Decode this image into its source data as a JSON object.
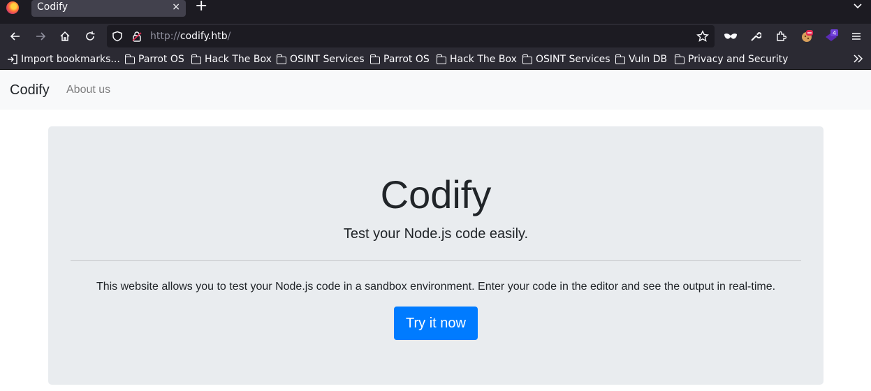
{
  "browser": {
    "tab": {
      "title": "Codify",
      "close": "×"
    },
    "newtab": "+",
    "url": {
      "protocol": "http://",
      "host": "codify.htb",
      "path": "/"
    },
    "extension_badge": "4",
    "bookmarks": [
      "Import bookmarks...",
      "Parrot OS",
      "Hack The Box",
      "OSINT Services",
      "Parrot OS",
      "Hack The Box",
      "OSINT Services",
      "Vuln DB",
      "Privacy and Security"
    ],
    "icons": [
      "firefox-logo",
      "back-arrow",
      "forward-arrow",
      "home",
      "reload",
      "shield",
      "lock",
      "star",
      "mask",
      "wrench",
      "extensions",
      "menu"
    ],
    "colors": {
      "accent": "#007bff",
      "jumbotron": "#e9ecef",
      "toolbar": "#2b2a33"
    }
  },
  "site": {
    "brand": "Codify",
    "nav_about": "About us",
    "hero_title": "Codify",
    "hero_lead": "Test your Node.js code easily.",
    "description": "This website allows you to test your Node.js code in a sandbox environment. Enter your code in the editor and see the output in real-time.",
    "cta_label": "Try it now"
  }
}
